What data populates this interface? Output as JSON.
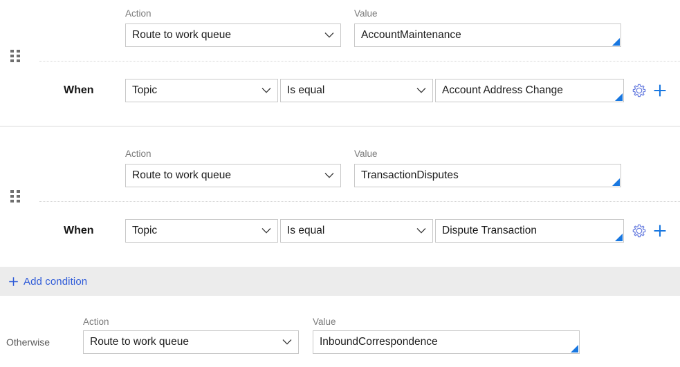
{
  "colors": {
    "accent_blue": "#1877e0",
    "link_blue": "#2f5bd8",
    "gear_blue": "#6a7fe0",
    "border_gray": "#c8c8c8",
    "label_gray": "#7a7a7a",
    "strip_gray": "#ececec"
  },
  "labels": {
    "action": "Action",
    "value": "Value",
    "when": "When",
    "otherwise": "Otherwise"
  },
  "conditions": [
    {
      "action_label": "Action",
      "action_value": "Route to work queue",
      "value_label": "Value",
      "value_value": "AccountMaintenance",
      "when_label": "When",
      "when_field": "Topic",
      "when_operator": "Is equal",
      "when_value": "Account Address Change"
    },
    {
      "action_label": "Action",
      "action_value": "Route to work queue",
      "value_label": "Value",
      "value_value": "TransactionDisputes",
      "when_label": "When",
      "when_field": "Topic",
      "when_operator": "Is equal",
      "when_value": "Dispute Transaction"
    }
  ],
  "add_condition": {
    "label": "Add condition"
  },
  "otherwise": {
    "row_label": "Otherwise",
    "action_label": "Action",
    "action_value": "Route to work queue",
    "value_label": "Value",
    "value_value": "InboundCorrespondence"
  }
}
